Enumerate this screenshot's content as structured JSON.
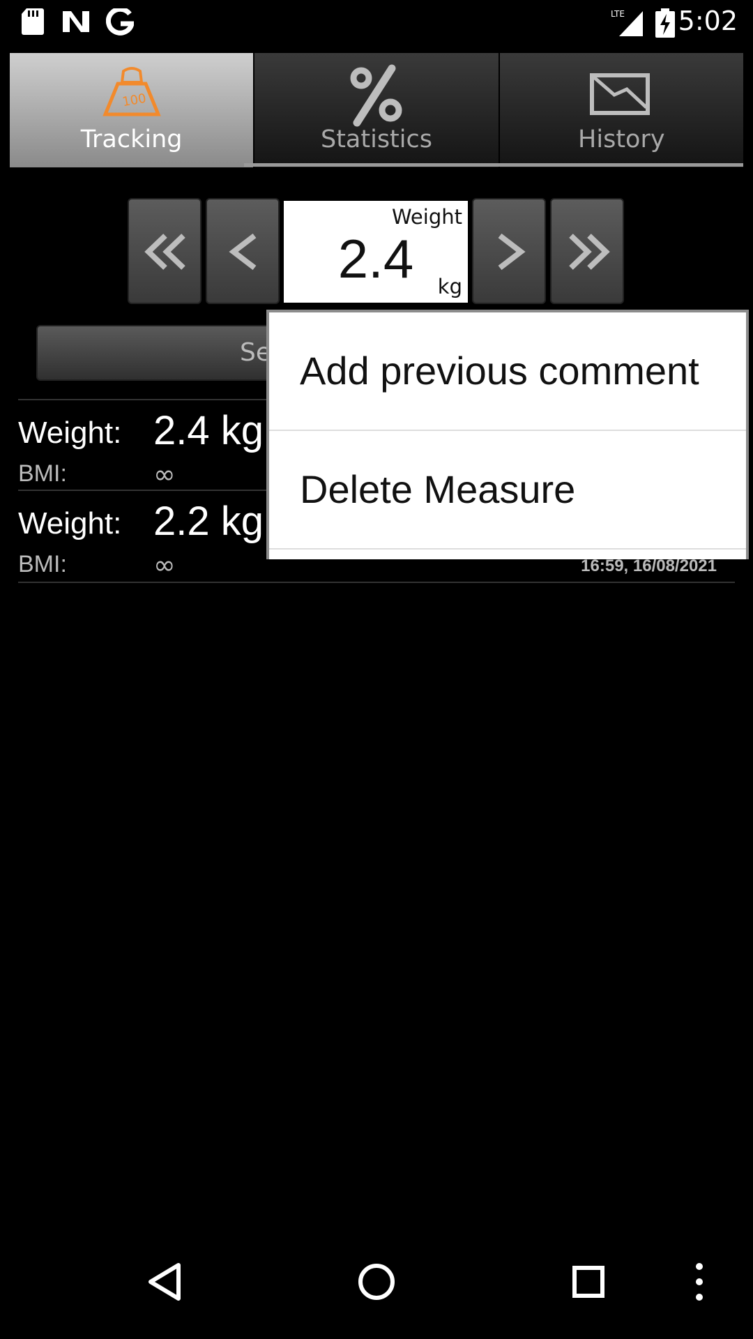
{
  "status_bar": {
    "time": "5:02",
    "network": "LTE",
    "icons": [
      "sd-card-icon",
      "n-notification-icon",
      "google-icon",
      "lte-signal-icon",
      "battery-charging-icon"
    ]
  },
  "tabs": [
    {
      "label": "Tracking",
      "icon": "weight-scale-icon",
      "selected": true
    },
    {
      "label": "Statistics",
      "icon": "percent-icon",
      "selected": false
    },
    {
      "label": "History",
      "icon": "history-chart-icon",
      "selected": false
    }
  ],
  "stepper": {
    "label": "Weight",
    "value": "2.4",
    "unit": "kg",
    "buttons": [
      "double-left-icon",
      "left-icon",
      "right-icon",
      "double-right-icon"
    ]
  },
  "save_button": {
    "label": "Se"
  },
  "entries": [
    {
      "weight_label": "Weight:",
      "weight_value": "2.4 kg",
      "bmi_label": "BMI:",
      "bmi_value": "∞",
      "date": ""
    },
    {
      "weight_label": "Weight:",
      "weight_value": "2.2 kg",
      "bmi_label": "BMI:",
      "bmi_value": "∞",
      "date": "16:59, 16/08/2021"
    }
  ],
  "context_menu": {
    "items": [
      "Add previous comment",
      "Delete Measure"
    ]
  },
  "colors": {
    "accent": "#f28a2c",
    "tab_selected": "#b0b0b0",
    "background": "#000000"
  },
  "nav_bar": {
    "buttons": [
      "back-icon",
      "home-icon",
      "recents-icon",
      "more-icon"
    ]
  }
}
